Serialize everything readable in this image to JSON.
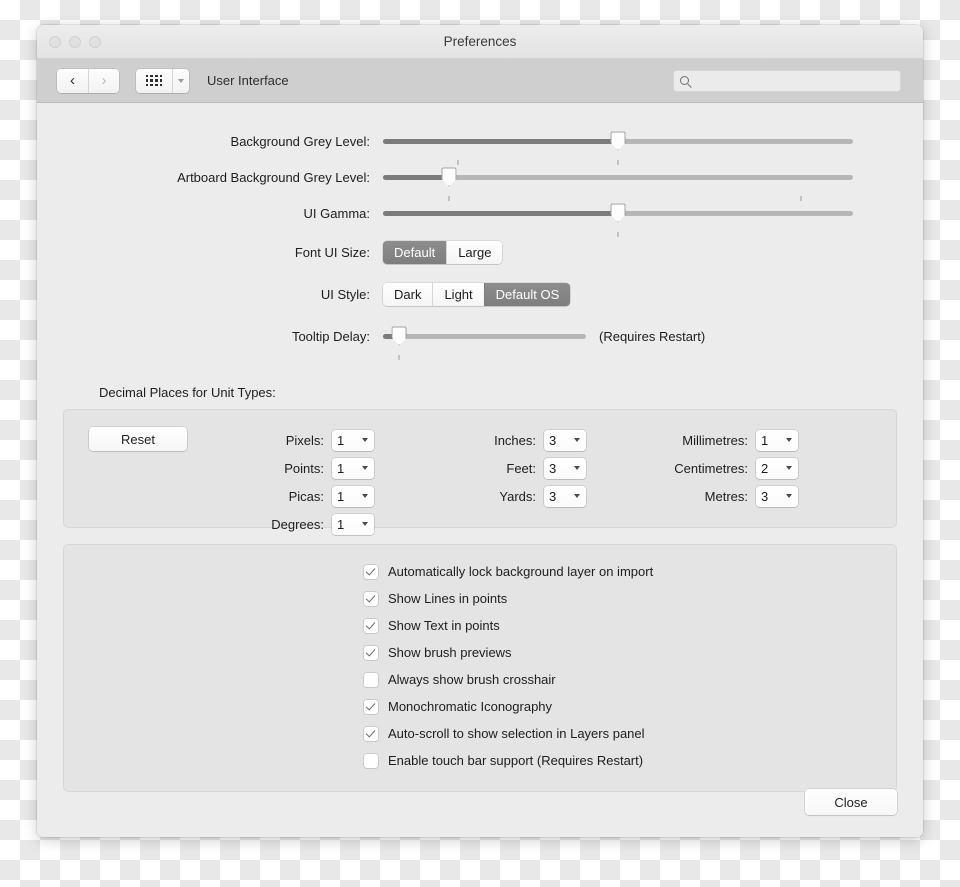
{
  "window": {
    "title": "Preferences"
  },
  "toolbar": {
    "back_icon": "chevron-left-icon",
    "forward_icon": "chevron-right-icon",
    "grid_icon": "grid-view-icon",
    "grid_dropdown_icon": "chevron-down-icon",
    "section_title": "User Interface",
    "search_icon": "search-icon",
    "search_value": "",
    "search_placeholder": ""
  },
  "sliders": [
    {
      "label": "Background Grey Level:",
      "value_pct": 50,
      "ticks": [
        16,
        50
      ]
    },
    {
      "label": "Artboard Background Grey Level:",
      "value_pct": 14,
      "ticks": [
        14,
        89
      ]
    },
    {
      "label": "UI Gamma:",
      "value_pct": 50,
      "ticks": [
        50
      ]
    }
  ],
  "tooltip_slider": {
    "label": "Tooltip Delay:",
    "value_pct": 8,
    "ticks": [
      8
    ],
    "note": "(Requires Restart)"
  },
  "font_ui_size": {
    "label": "Font UI Size:",
    "options": [
      "Default",
      "Large"
    ],
    "selected": "Default"
  },
  "ui_style": {
    "label": "UI Style:",
    "options": [
      "Dark",
      "Light",
      "Default OS"
    ],
    "selected": "Default OS"
  },
  "decimal_section": {
    "heading": "Decimal Places for Unit Types:",
    "reset_label": "Reset",
    "columns": [
      [
        {
          "label": "Pixels:",
          "value": "1"
        },
        {
          "label": "Points:",
          "value": "1"
        },
        {
          "label": "Picas:",
          "value": "1"
        },
        {
          "label": "Degrees:",
          "value": "1"
        }
      ],
      [
        {
          "label": "Inches:",
          "value": "3"
        },
        {
          "label": "Feet:",
          "value": "3"
        },
        {
          "label": "Yards:",
          "value": "3"
        }
      ],
      [
        {
          "label": "Millimetres:",
          "value": "1"
        },
        {
          "label": "Centimetres:",
          "value": "2"
        },
        {
          "label": "Metres:",
          "value": "3"
        }
      ]
    ]
  },
  "checkboxes": [
    {
      "label": "Automatically lock background layer on import",
      "checked": true
    },
    {
      "label": "Show Lines in points",
      "checked": true
    },
    {
      "label": "Show Text in points",
      "checked": true
    },
    {
      "label": "Show brush previews",
      "checked": true
    },
    {
      "label": "Always show brush crosshair",
      "checked": false
    },
    {
      "label": "Monochromatic Iconography",
      "checked": true
    },
    {
      "label": "Auto-scroll to show selection in Layers panel",
      "checked": true
    },
    {
      "label": "Enable touch bar support (Requires Restart)",
      "checked": false
    }
  ],
  "footer": {
    "close_label": "Close"
  },
  "colors": {
    "window_bg": "#ececec",
    "toolbar_bg": "#cfcfcf",
    "panel_bg": "#e4e4e4",
    "slider_fill": "#7b7b7b",
    "slider_track": "#b6b6b6",
    "segment_active": "#8d8d8d"
  }
}
